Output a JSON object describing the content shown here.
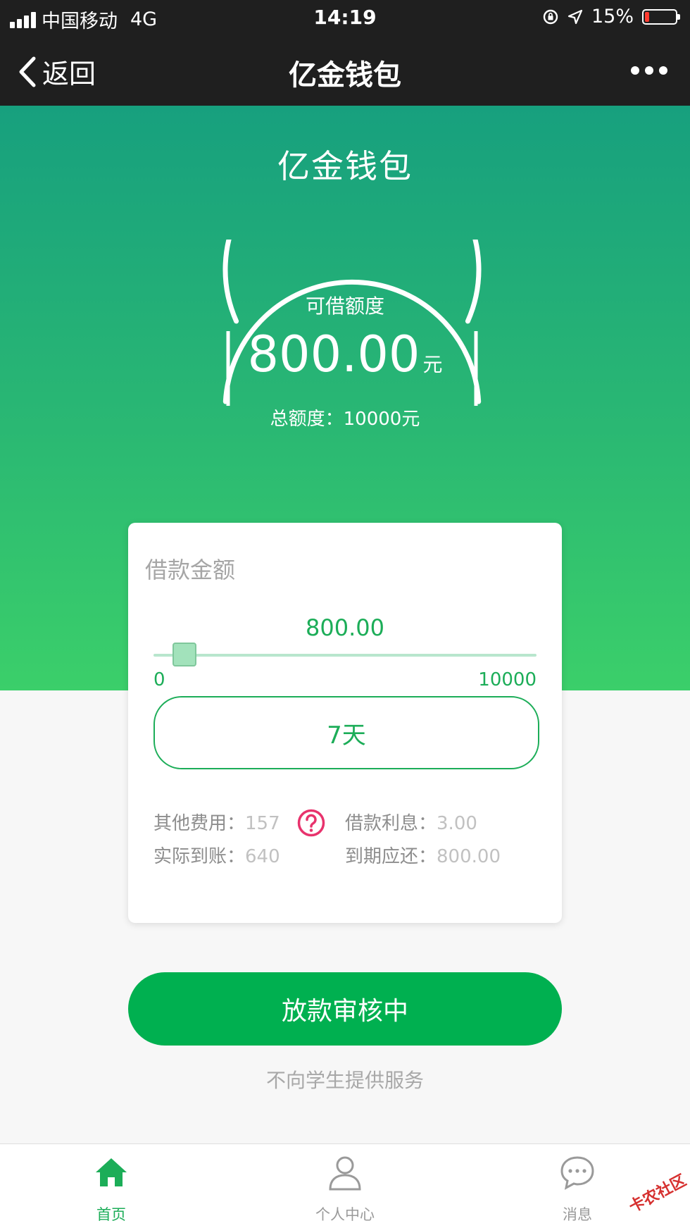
{
  "status_bar": {
    "carrier": "中国移动",
    "network": "4G",
    "time": "14:19",
    "battery": "15%",
    "battery_level": 0.15
  },
  "nav": {
    "back_label": "返回",
    "title": "亿金钱包"
  },
  "hero": {
    "title": "亿金钱包",
    "credit_label": "可借额度",
    "credit_amount": "800.00",
    "credit_unit": "元",
    "total_text": "总额度：10000元"
  },
  "loan_card": {
    "heading": "借款金额",
    "amount": "800.00",
    "slider_min": "0",
    "slider_max": "10000",
    "slider_value": 800,
    "term": "7天",
    "fees": {
      "other_label": "其他费用：",
      "other_value": "157",
      "interest_label": "借款利息：",
      "interest_value": "3.00",
      "received_label": "实际到账：",
      "received_value": "640",
      "due_label": "到期应还：",
      "due_value": "800.00"
    }
  },
  "cta": {
    "label": "放款审核中"
  },
  "footnote": "不向学生提供服务",
  "tabbar": [
    {
      "label": "首页",
      "icon": "home-icon",
      "active": true
    },
    {
      "label": "个人中心",
      "icon": "person-icon",
      "active": false
    },
    {
      "label": "消息",
      "icon": "message-icon",
      "active": false
    }
  ],
  "watermark": "卡农社区",
  "colors": {
    "accent": "#1cad58",
    "cta": "#00b050",
    "help": "#e8336d",
    "hero_top": "#17a07e",
    "hero_bottom": "#3bcf6a"
  }
}
